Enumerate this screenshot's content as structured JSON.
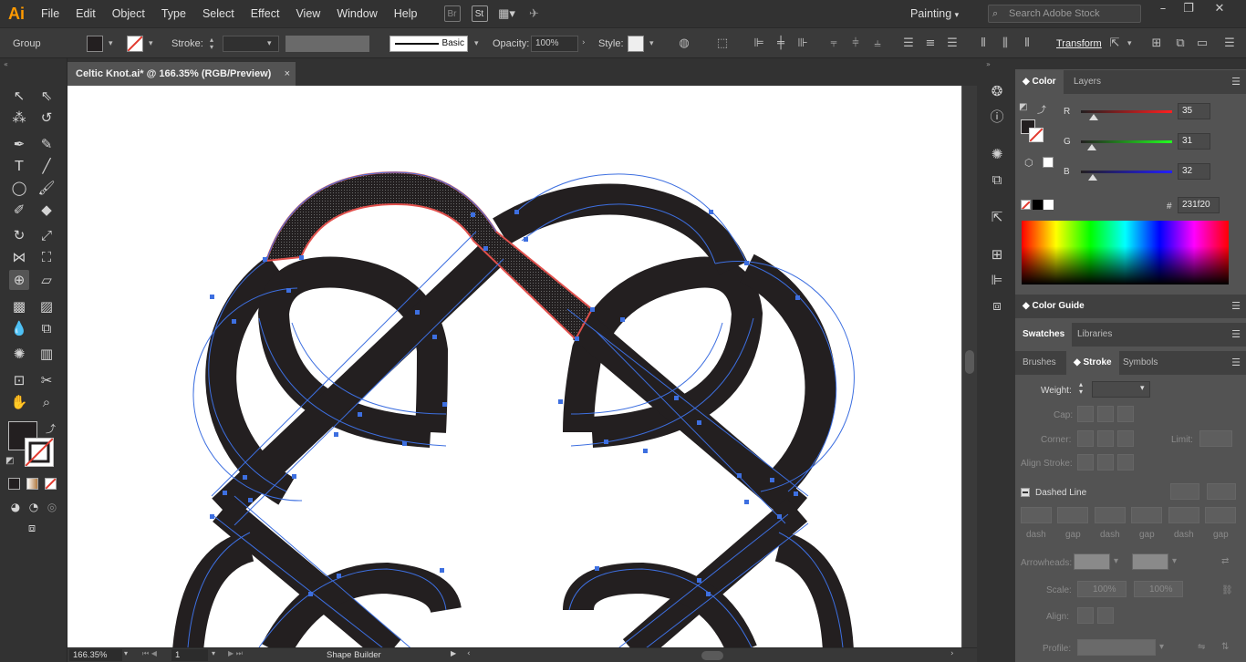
{
  "app": {
    "logo": "Ai"
  },
  "menu": [
    "File",
    "Edit",
    "Object",
    "Type",
    "Select",
    "Effect",
    "View",
    "Window",
    "Help"
  ],
  "menubar_icons": {
    "br": "Br",
    "st": "St"
  },
  "workspace": "Painting",
  "search": {
    "placeholder": "Search Adobe Stock"
  },
  "control_bar": {
    "selection_type": "Group",
    "stroke_label": "Stroke:",
    "brush_label": "Basic",
    "opacity_label": "Opacity:",
    "opacity_value": "100%",
    "style_label": "Style:",
    "transform_label": "Transform"
  },
  "document": {
    "tab_title": "Celtic Knot.ai* @ 166.35% (RGB/Preview)",
    "close": "×"
  },
  "status": {
    "zoom": "166.35%",
    "artboard": "1",
    "tool": "Shape Builder"
  },
  "color_panel": {
    "tabs": [
      "Color",
      "Layers"
    ],
    "channels": [
      {
        "label": "R",
        "value": "35",
        "fraction": 0.137
      },
      {
        "label": "G",
        "value": "31",
        "fraction": 0.122
      },
      {
        "label": "B",
        "value": "32",
        "fraction": 0.125
      }
    ],
    "hex_label": "#",
    "hex": "231f20",
    "fill_color": "#231f20"
  },
  "color_guide": {
    "title": "Color Guide"
  },
  "swatches_panel": {
    "tabs": [
      "Swatches",
      "Libraries"
    ]
  },
  "stroke_panel": {
    "tabs": [
      "Brushes",
      "Stroke",
      "Symbols"
    ],
    "weight_label": "Weight:",
    "cap_label": "Cap:",
    "corner_label": "Corner:",
    "limit_label": "Limit:",
    "align_label": "Align Stroke:",
    "dashed_label": "Dashed Line",
    "dash_fields": [
      "dash",
      "gap",
      "dash",
      "gap",
      "dash",
      "gap"
    ],
    "arrowheads_label": "Arrowheads:",
    "scale_label": "Scale:",
    "scale_values": [
      "100%",
      "100%"
    ],
    "align2_label": "Align:",
    "profile_label": "Profile:"
  },
  "colors": {
    "accent": "#ff9a00",
    "path": "#231f20",
    "anchor": "#3d6fe0",
    "highlight": "#e0504c"
  }
}
